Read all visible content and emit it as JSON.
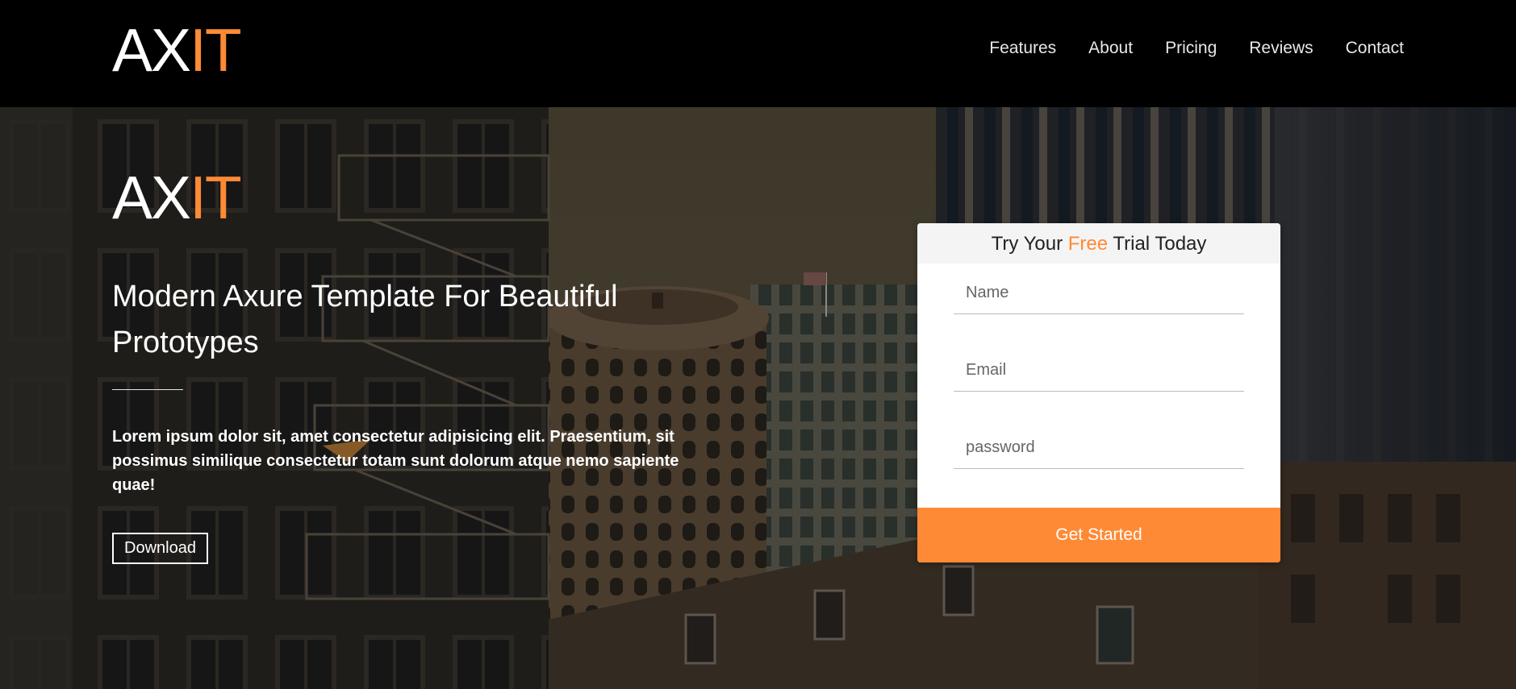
{
  "nav": {
    "brand_prefix": "AX",
    "brand_accent": "IT",
    "links": [
      "Features",
      "About",
      "Pricing",
      "Reviews",
      "Contact"
    ]
  },
  "hero": {
    "brand_prefix": "AX",
    "brand_accent": "IT",
    "heading": "Modern Axure Template For Beautiful Prototypes",
    "description": "Lorem ipsum dolor sit, amet consectetur adipisicing elit. Praesentium, sit possimus similique consectetur totam sunt dolorum atque nemo sapiente quae!",
    "download_label": "Download"
  },
  "signup": {
    "title_start": "Try Your ",
    "title_accent": "Free",
    "title_end": " Trial Today",
    "name_placeholder": "Name",
    "email_placeholder": "Email",
    "password_placeholder": "password",
    "submit_label": "Get Started"
  },
  "colors": {
    "accent": "#ff8a35",
    "navbar_bg": "#000000",
    "card_bg": "#ffffff",
    "card_header_bg": "#f4f4f4"
  },
  "icons": {
    "background": "city-buildings-photo"
  }
}
